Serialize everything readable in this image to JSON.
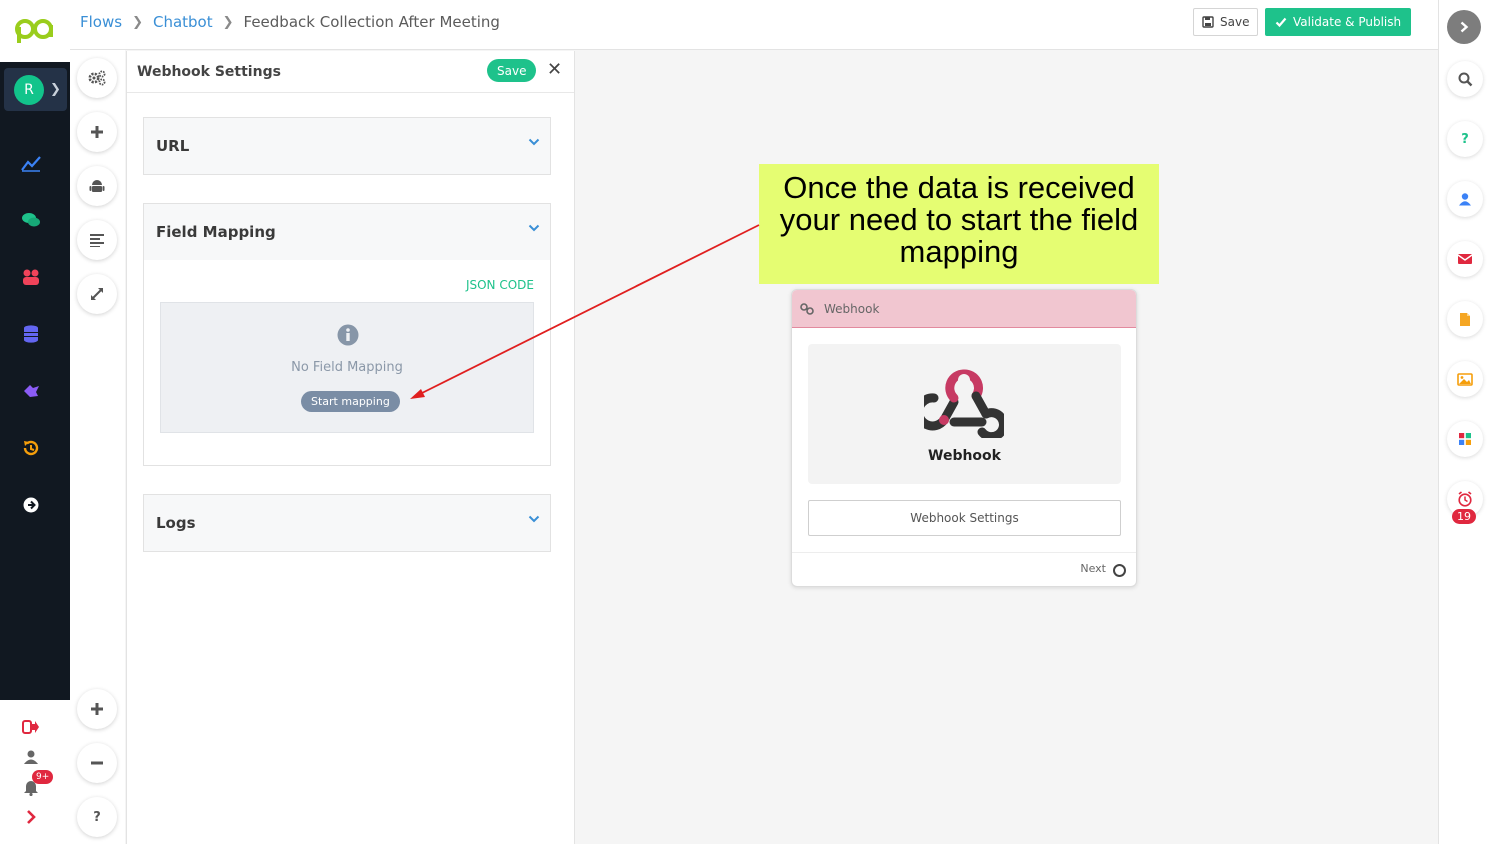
{
  "breadcrumb": {
    "items": [
      "Flows",
      "Chatbot"
    ],
    "current": "Feedback Collection After Meeting"
  },
  "header": {
    "save_label": "Save",
    "publish_label": "Validate & Publish"
  },
  "nav": {
    "avatar_initial": "R",
    "notification_badge": "9+"
  },
  "panel": {
    "title": "Webhook Settings",
    "save_label": "Save",
    "close_label": "✕",
    "sections": {
      "url": "URL",
      "field_mapping": "Field Mapping",
      "logs": "Logs"
    },
    "json_code_label": "JSON CODE",
    "no_mapping_text": "No Field Mapping",
    "start_mapping_label": "Start mapping"
  },
  "callout": {
    "text": "Once the data is received your need to start the field mapping"
  },
  "node": {
    "header_label": "Webhook",
    "name": "Webhook",
    "settings_label": "Webhook Settings",
    "next_label": "Next"
  },
  "rail": {
    "reminder_badge": "19"
  },
  "colors": {
    "accent_green": "#1ec28b",
    "link_blue": "#3a8fd6",
    "sidebar_dark": "#111821",
    "callout_yellow": "#e5fd72",
    "node_header_pink": "#f1c6d0",
    "arrow_red": "#e01f1f"
  }
}
